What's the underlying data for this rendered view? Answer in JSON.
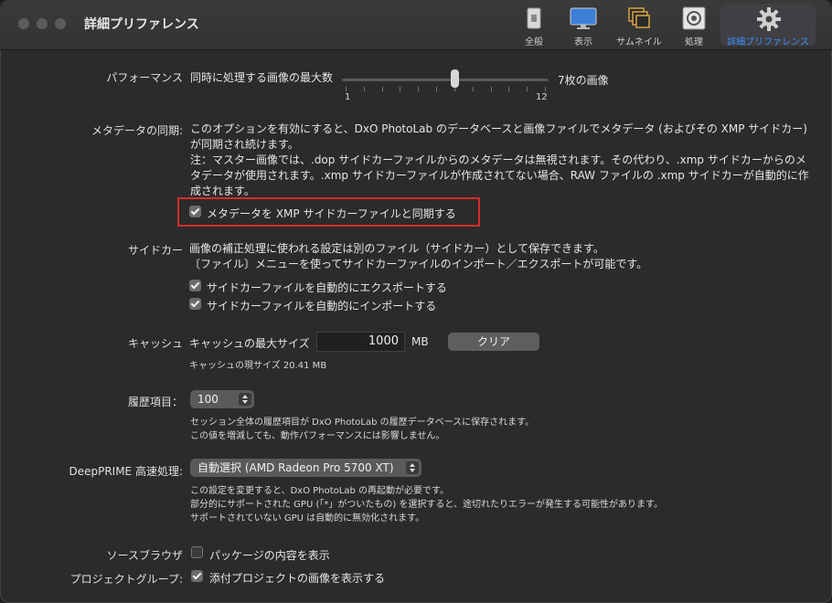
{
  "window": {
    "title": "詳細プリファレンス"
  },
  "toolbar": [
    {
      "label": "全般",
      "icon": "general-icon"
    },
    {
      "label": "表示",
      "icon": "display-icon"
    },
    {
      "label": "サムネイル",
      "icon": "thumbnail-icon"
    },
    {
      "label": "処理",
      "icon": "processing-icon"
    },
    {
      "label": "詳細プリファレンス",
      "icon": "gear-icon",
      "active": true
    }
  ],
  "performance": {
    "label": "パフォーマンス",
    "description": "同時に処理する画像の最大数",
    "slider_min": "1",
    "slider_max": "12",
    "value_text": "7枚の画像",
    "value": 7
  },
  "metadata_sync": {
    "label": "メタデータの同期:",
    "lines": [
      "このオプションを有効にすると、DxO PhotoLab のデータベースと画像ファイルでメタデータ (およびその XMP サイドカー)",
      "が同期され続けます。",
      "注：マスター画像では、.dop サイドカーファイルからのメタデータは無視されます。その代わり、.xmp サイドカーからのメ",
      "タデータが使用されます。.xmp サイドカーファイルが作成されてない場合、RAW ファイルの .xmp サイドカーが自動的に作",
      "成されます。"
    ],
    "checkbox_label": "メタデータを XMP サイドカーファイルと同期する",
    "checked": true
  },
  "sidecar": {
    "label": "サイドカー",
    "lines": [
      "画像の補正処理に使われる設定は別のファイル（サイドカー）として保存できます。",
      "〔ファイル〕メニューを使ってサイドカーファイルのインポート／エクスポートが可能です。"
    ],
    "export_label": "サイドカーファイルを自動的にエクスポートする",
    "import_label": "サイドカーファイルを自動的にインポートする"
  },
  "cache": {
    "label": "キャッシュ",
    "max_size_label": "キャッシュの最大サイズ",
    "max_size_value": "1000",
    "unit": "MB",
    "clear_button": "クリア",
    "current_size": "キャッシュの現サイズ 20.41 MB"
  },
  "history": {
    "label": "履歴項目：",
    "value": "100",
    "lines": [
      "セッション全体の履歴項目が DxO PhotoLab の履歴データベースに保存されます。",
      "この値を増減しても、動作パフォーマンスには影響しません。"
    ]
  },
  "deepprime": {
    "label": "DeepPRIME 高速処理:",
    "value": "自動選択 (AMD Radeon Pro 5700 XT)",
    "lines": [
      "この設定を変更すると、DxO PhotoLab の再起動が必要です。",
      "部分的にサポートされた GPU (「*」がついたもの) を選択すると、途切れたりエラーが発生する可能性があります。",
      "サポートされていない GPU は自動的に無効化されます。"
    ]
  },
  "source_browser": {
    "label": "ソースブラウザ",
    "checkbox_label": "パッケージの内容を表示",
    "checked": false
  },
  "project_group": {
    "label": "プロジェクトグループ:",
    "checkbox_label": "添付プロジェクトの画像を表示する",
    "checked": true
  }
}
